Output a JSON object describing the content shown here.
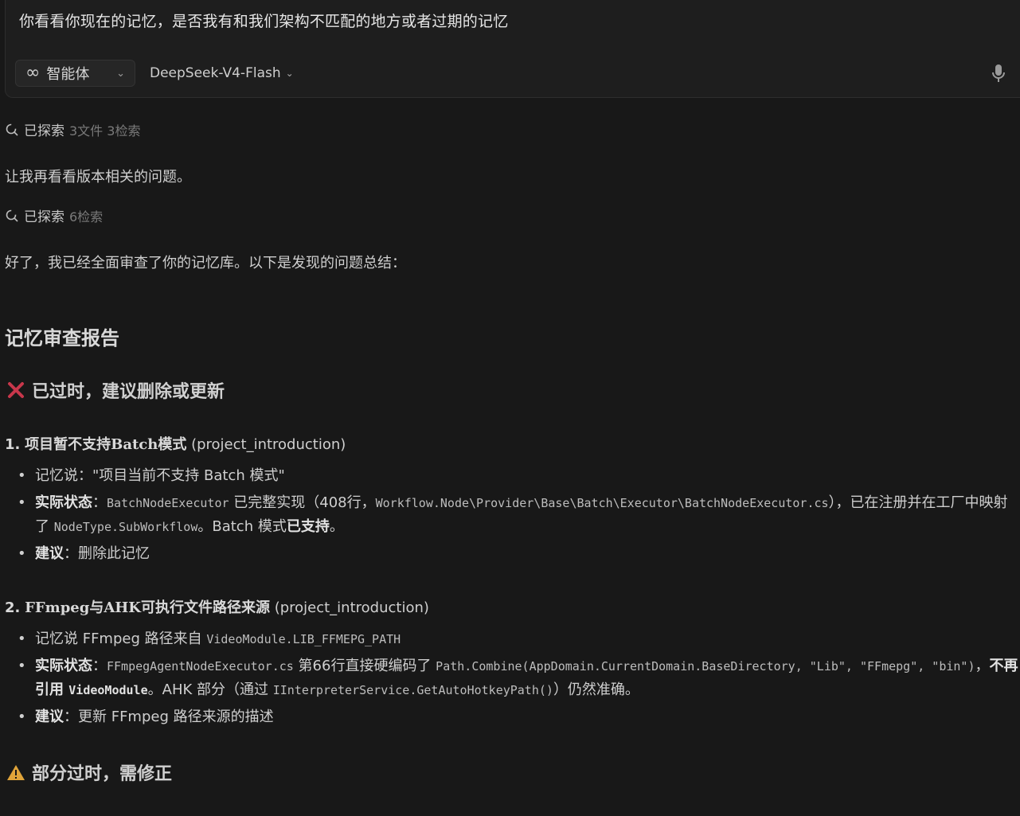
{
  "composer": {
    "prompt": "你看看你现在的记忆，是否我有和我们架构不匹配的地方或者过期的记忆",
    "agent_label": "智能体",
    "model_label": "DeepSeek-V4-Flash"
  },
  "explore1": {
    "label": "已探索",
    "detail": "3文件 3检索"
  },
  "msg1": "让我再看看版本相关的问题。",
  "explore2": {
    "label": "已探索",
    "detail": "6检索"
  },
  "msg2": "好了，我已经全面审查了你的记忆库。以下是发现的问题总结：",
  "report": {
    "title": "记忆审查报告",
    "section_outdated": {
      "title": "已过时，建议删除或更新"
    },
    "item1": {
      "num": "1.",
      "title": "项目暂不支持Batch模式",
      "tag": " (project_introduction)",
      "b1": "记忆说：\"项目当前不支持 Batch 模式\"",
      "b2_label": "实际状态",
      "b2_sep": "：",
      "b2_code1": "BatchNodeExecutor",
      "b2_t1": " 已完整实现（408行，",
      "b2_code2": "Workflow.Node\\Provider\\Base\\Batch\\Executor\\BatchNodeExecutor.cs",
      "b2_t2": "），已在注册并在工厂中映射了 ",
      "b2_code3": "NodeType.SubWorkflow",
      "b2_t3": "。Batch 模式",
      "b2_bold": "已支持",
      "b2_t4": "。",
      "b3_label": "建议",
      "b3_sep": "：",
      "b3_text": "删除此记忆"
    },
    "item2": {
      "num": "2.",
      "title": "FFmpeg与AHK可执行文件路径来源",
      "tag": " (project_introduction)",
      "b1_text": "记忆说 FFmpeg 路径来自 ",
      "b1_code": "VideoModule.LIB_FFMEPG_PATH",
      "b2_label": "实际状态",
      "b2_sep": "：",
      "b2_code1": "FFmpegAgentNodeExecutor.cs",
      "b2_t1": " 第66行直接硬编码了 ",
      "b2_code2": "Path.Combine(AppDomain.CurrentDomain.BaseDirectory, \"Lib\", \"FFmepg\", \"bin\")",
      "b2_t2": "，",
      "b2_bold": "不再引用 ",
      "b2_boldcode": "VideoModule",
      "b2_t3": "。AHK 部分（通过 ",
      "b2_code3": "IInterpreterService.GetAutoHotkeyPath()",
      "b2_t4": "）仍然准确。",
      "b3_label": "建议",
      "b3_sep": "：",
      "b3_text": "更新 FFmpeg 路径来源的描述"
    },
    "section_partial": {
      "title": "部分过时，需修正"
    }
  }
}
